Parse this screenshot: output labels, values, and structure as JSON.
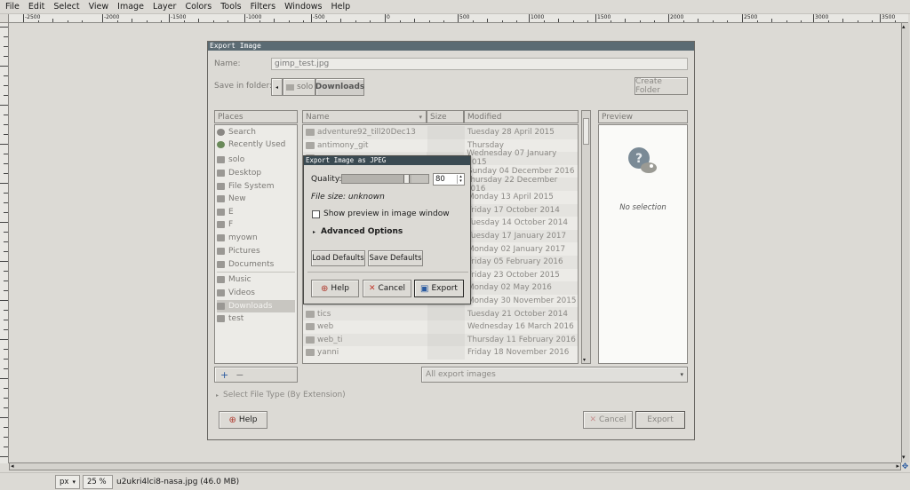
{
  "menu": [
    "File",
    "Edit",
    "Select",
    "View",
    "Image",
    "Layer",
    "Colors",
    "Tools",
    "Filters",
    "Windows",
    "Help"
  ],
  "ruler_labels": [
    "-2500",
    "-2000",
    "-1500",
    "-1000",
    "-500",
    "0",
    "500",
    "1000",
    "1500",
    "2000",
    "2500",
    "3000",
    "3500"
  ],
  "status": {
    "unit": "px",
    "zoom": "25 %",
    "file_info": "u2ukri4lci8-nasa.jpg (46.0 MB)"
  },
  "export_dialog": {
    "title": "Export Image",
    "name_label": "Name:",
    "name_value": "gimp_test.jpg",
    "save_in_label": "Save in folder:",
    "path": [
      "solo",
      "Downloads"
    ],
    "create_folder": "Create Folder",
    "places_header": "Places",
    "places": [
      "Search",
      "Recently Used",
      "solo",
      "Desktop",
      "File System",
      "New",
      "E",
      "F",
      "myown",
      "Pictures",
      "Documents",
      "Music",
      "Videos",
      "Downloads",
      "test"
    ],
    "columns": {
      "name": "Name",
      "size": "Size",
      "modified": "Modified"
    },
    "files": [
      {
        "name": "adventure92_till20Dec13",
        "modified": "Tuesday 28 April 2015"
      },
      {
        "name": "antimony_git",
        "modified": "Thursday"
      },
      {
        "name": "",
        "modified": "Wednesday 07 January 2015"
      },
      {
        "name": "",
        "modified": "Sunday 04 December 2016"
      },
      {
        "name": "",
        "modified": "Thursday 22 December 2016"
      },
      {
        "name": "",
        "modified": "Monday 13 April 2015"
      },
      {
        "name": "",
        "modified": "Friday 17 October 2014"
      },
      {
        "name": "",
        "modified": "Tuesday 14 October 2014"
      },
      {
        "name": "",
        "modified": "Tuesday 17 January 2017"
      },
      {
        "name": "",
        "modified": "Monday 02 January 2017"
      },
      {
        "name": "",
        "modified": "Friday 05 February 2016"
      },
      {
        "name": "",
        "modified": "Friday 23 October 2015"
      },
      {
        "name": "",
        "modified": "Monday 02 May 2016"
      },
      {
        "name": "",
        "modified": "Monday 30 November 2015"
      },
      {
        "name": "tics",
        "modified": "Tuesday 21 October 2014"
      },
      {
        "name": "web",
        "modified": "Wednesday 16 March 2016"
      },
      {
        "name": "web_ti",
        "modified": "Thursday 11 February 2016"
      },
      {
        "name": "yanni",
        "modified": "Friday 18 November 2016"
      }
    ],
    "preview_header": "Preview",
    "preview_text": "No selection",
    "filter": "All export images",
    "select_type": "Select File Type (By Extension)",
    "help": "Help",
    "cancel": "Cancel",
    "export": "Export"
  },
  "jpeg_dialog": {
    "title": "Export Image as JPEG",
    "quality_label": "Quality:",
    "quality_value": "80",
    "quality": 0.8,
    "file_size": "File size: unknown",
    "show_preview": "Show preview in image window",
    "advanced": "Advanced Options",
    "load_defaults": "Load Defaults",
    "save_defaults": "Save Defaults",
    "help": "Help",
    "cancel": "Cancel",
    "export": "Export"
  },
  "colors": {
    "titlebar": "#5b6b73",
    "jpeg_titlebar": "#3a4a52",
    "cancel_x": "#c0392b",
    "help_icon": "#b03a2e",
    "export_icon": "#2a5aa0"
  }
}
